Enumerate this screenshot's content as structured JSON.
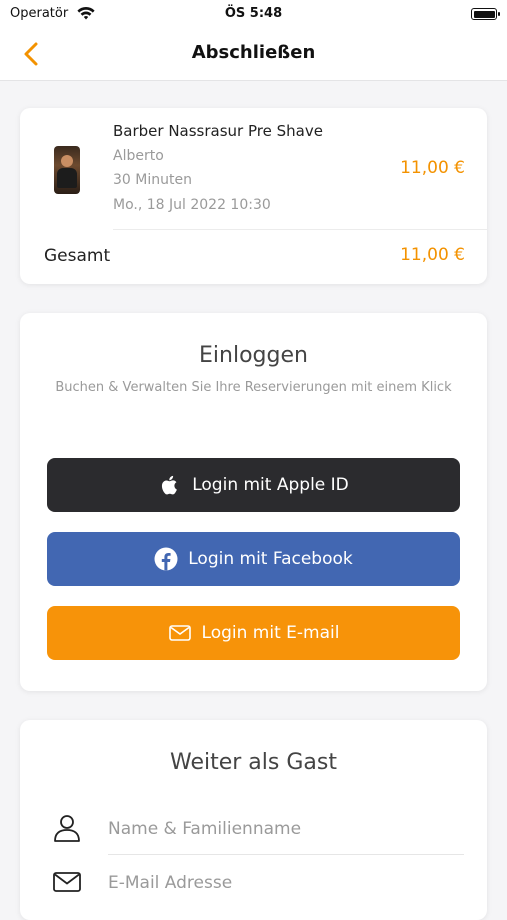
{
  "status_bar": {
    "carrier": "Operatör",
    "time": "ÖS 5:48"
  },
  "nav": {
    "title": "Abschließen"
  },
  "summary": {
    "service": "Barber Nassrasur Pre Shave",
    "staff": "Alberto",
    "duration": "30 Minuten",
    "datetime": "Mo., 18 Jul 2022 10:30",
    "price": "11,00 €",
    "total_label": "Gesamt",
    "total": "11,00 €"
  },
  "login": {
    "title": "Einloggen",
    "subtitle": "Buchen & Verwalten Sie Ihre Reservierungen mit einem Klick",
    "apple_label": "Login mit Apple ID",
    "facebook_label": "Login mit Facebook",
    "email_label": "Login mit E-mail"
  },
  "guest": {
    "title": "Weiter als Gast",
    "name_placeholder": "Name & Familienname",
    "email_placeholder": "E-Mail Adresse"
  },
  "colors": {
    "accent": "#f39200",
    "apple": "#2b2b2e",
    "facebook": "#4267b2",
    "email": "#f79309"
  },
  "icons": [
    "wifi-icon",
    "battery-icon",
    "back-chevron-icon",
    "apple-icon",
    "facebook-icon",
    "mail-icon",
    "person-icon",
    "envelope-icon"
  ]
}
